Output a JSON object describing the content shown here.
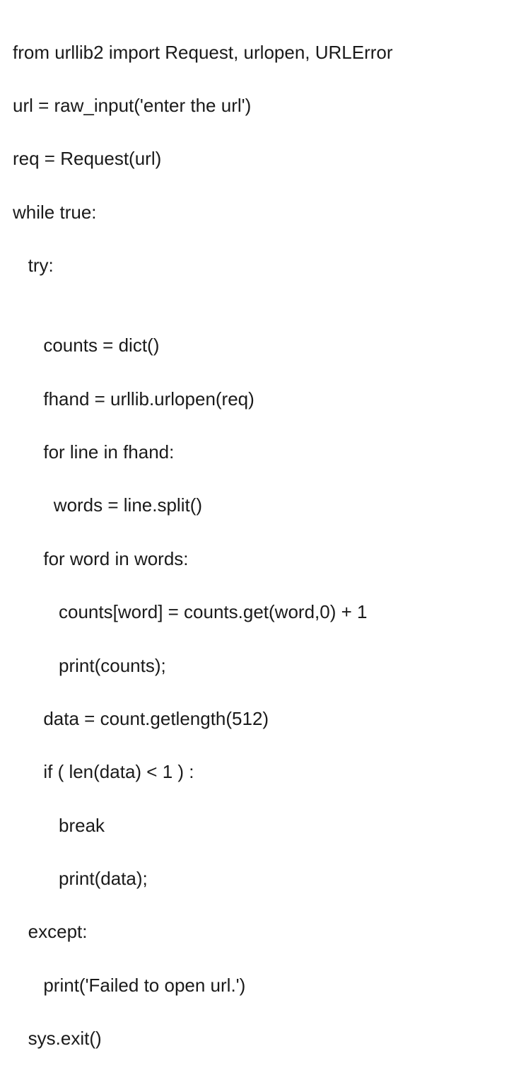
{
  "code": {
    "lines": [
      "from urllib2 import Request, urlopen, URLError",
      "url = raw_input('enter the url')",
      "req = Request(url)",
      "while true:",
      "   try:",
      "",
      "      counts = dict()",
      "      fhand = urllib.urlopen(req)",
      "      for line in fhand:",
      "        words = line.split()",
      "      for word in words:",
      "         counts[word] = counts.get(word,0) + 1",
      "         print(counts);",
      "      data = count.getlength(512)",
      "      if ( len(data) < 1 ) :",
      "         break",
      "         print(data);",
      "   except:",
      "      print('Failed to open url.')",
      "   sys.exit()"
    ]
  }
}
